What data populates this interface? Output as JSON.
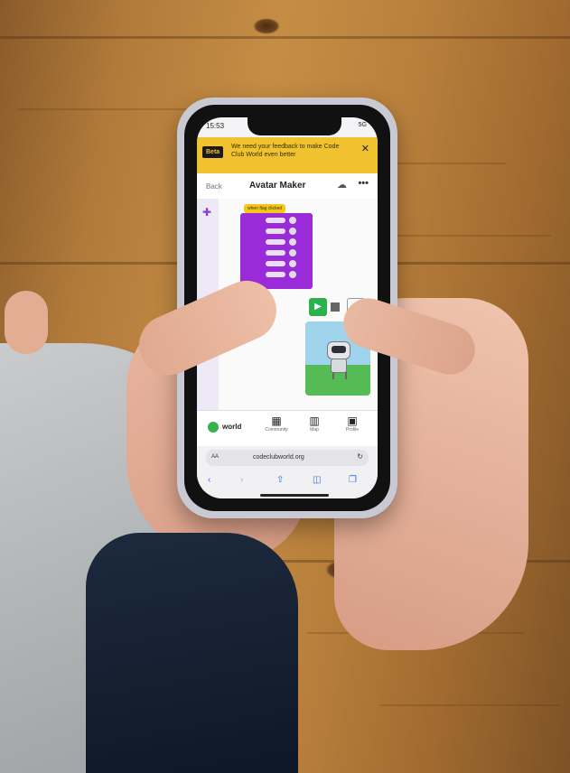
{
  "phone": {
    "status": {
      "time": "15:53",
      "right": "5G"
    },
    "banner": {
      "badge": "Beta",
      "message": "We need your feedback to make Code Club World even better",
      "close": "✕"
    },
    "header": {
      "back": "Back",
      "title": "Avatar Maker",
      "cloud_icon": "cloud-icon",
      "more": "•••"
    },
    "editor": {
      "start_block": "when flag clicked",
      "play": "▶",
      "expand": "⤢"
    },
    "nav": {
      "logo_text": "world",
      "community": "Community",
      "map": "Map",
      "profile": "Profile"
    },
    "browser": {
      "aa": "AA",
      "url": "codeclubworld.org",
      "reload": "↻"
    }
  }
}
